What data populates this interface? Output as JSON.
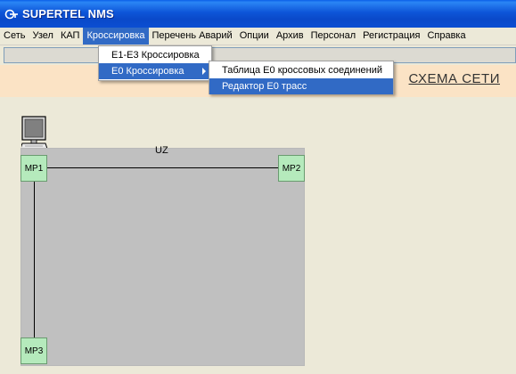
{
  "window": {
    "title": "SUPERTEL NMS",
    "icon": "supertel-logo-icon"
  },
  "menubar": [
    "Сеть",
    "Узел",
    "КАП",
    "Кроссировка",
    "Перечень Аварий",
    "Опции",
    "Архив",
    "Персонал",
    "Регистрация",
    "Справка"
  ],
  "active_menu": "Кроссировка",
  "crossing_menu": {
    "items": [
      "E1-E3 Кроссировка",
      "E0 Кроссировка"
    ],
    "highlighted": "E0 Кроссировка"
  },
  "e0_submenu": {
    "items": [
      "Таблица E0 кроссовых соединений",
      "Редактор E0 трасс"
    ],
    "highlighted": "Редактор E0 трасс"
  },
  "header": {
    "network_link": "СХЕМА СЕТИ"
  },
  "diagram": {
    "zone_label": "UZ",
    "nodes": [
      {
        "label": "MP1"
      },
      {
        "label": "MP2"
      },
      {
        "label": "MP3"
      }
    ],
    "colors": {
      "zone": "#c0c0c0",
      "node": "#b5eabc",
      "header_band": "#fbe3c5"
    }
  }
}
